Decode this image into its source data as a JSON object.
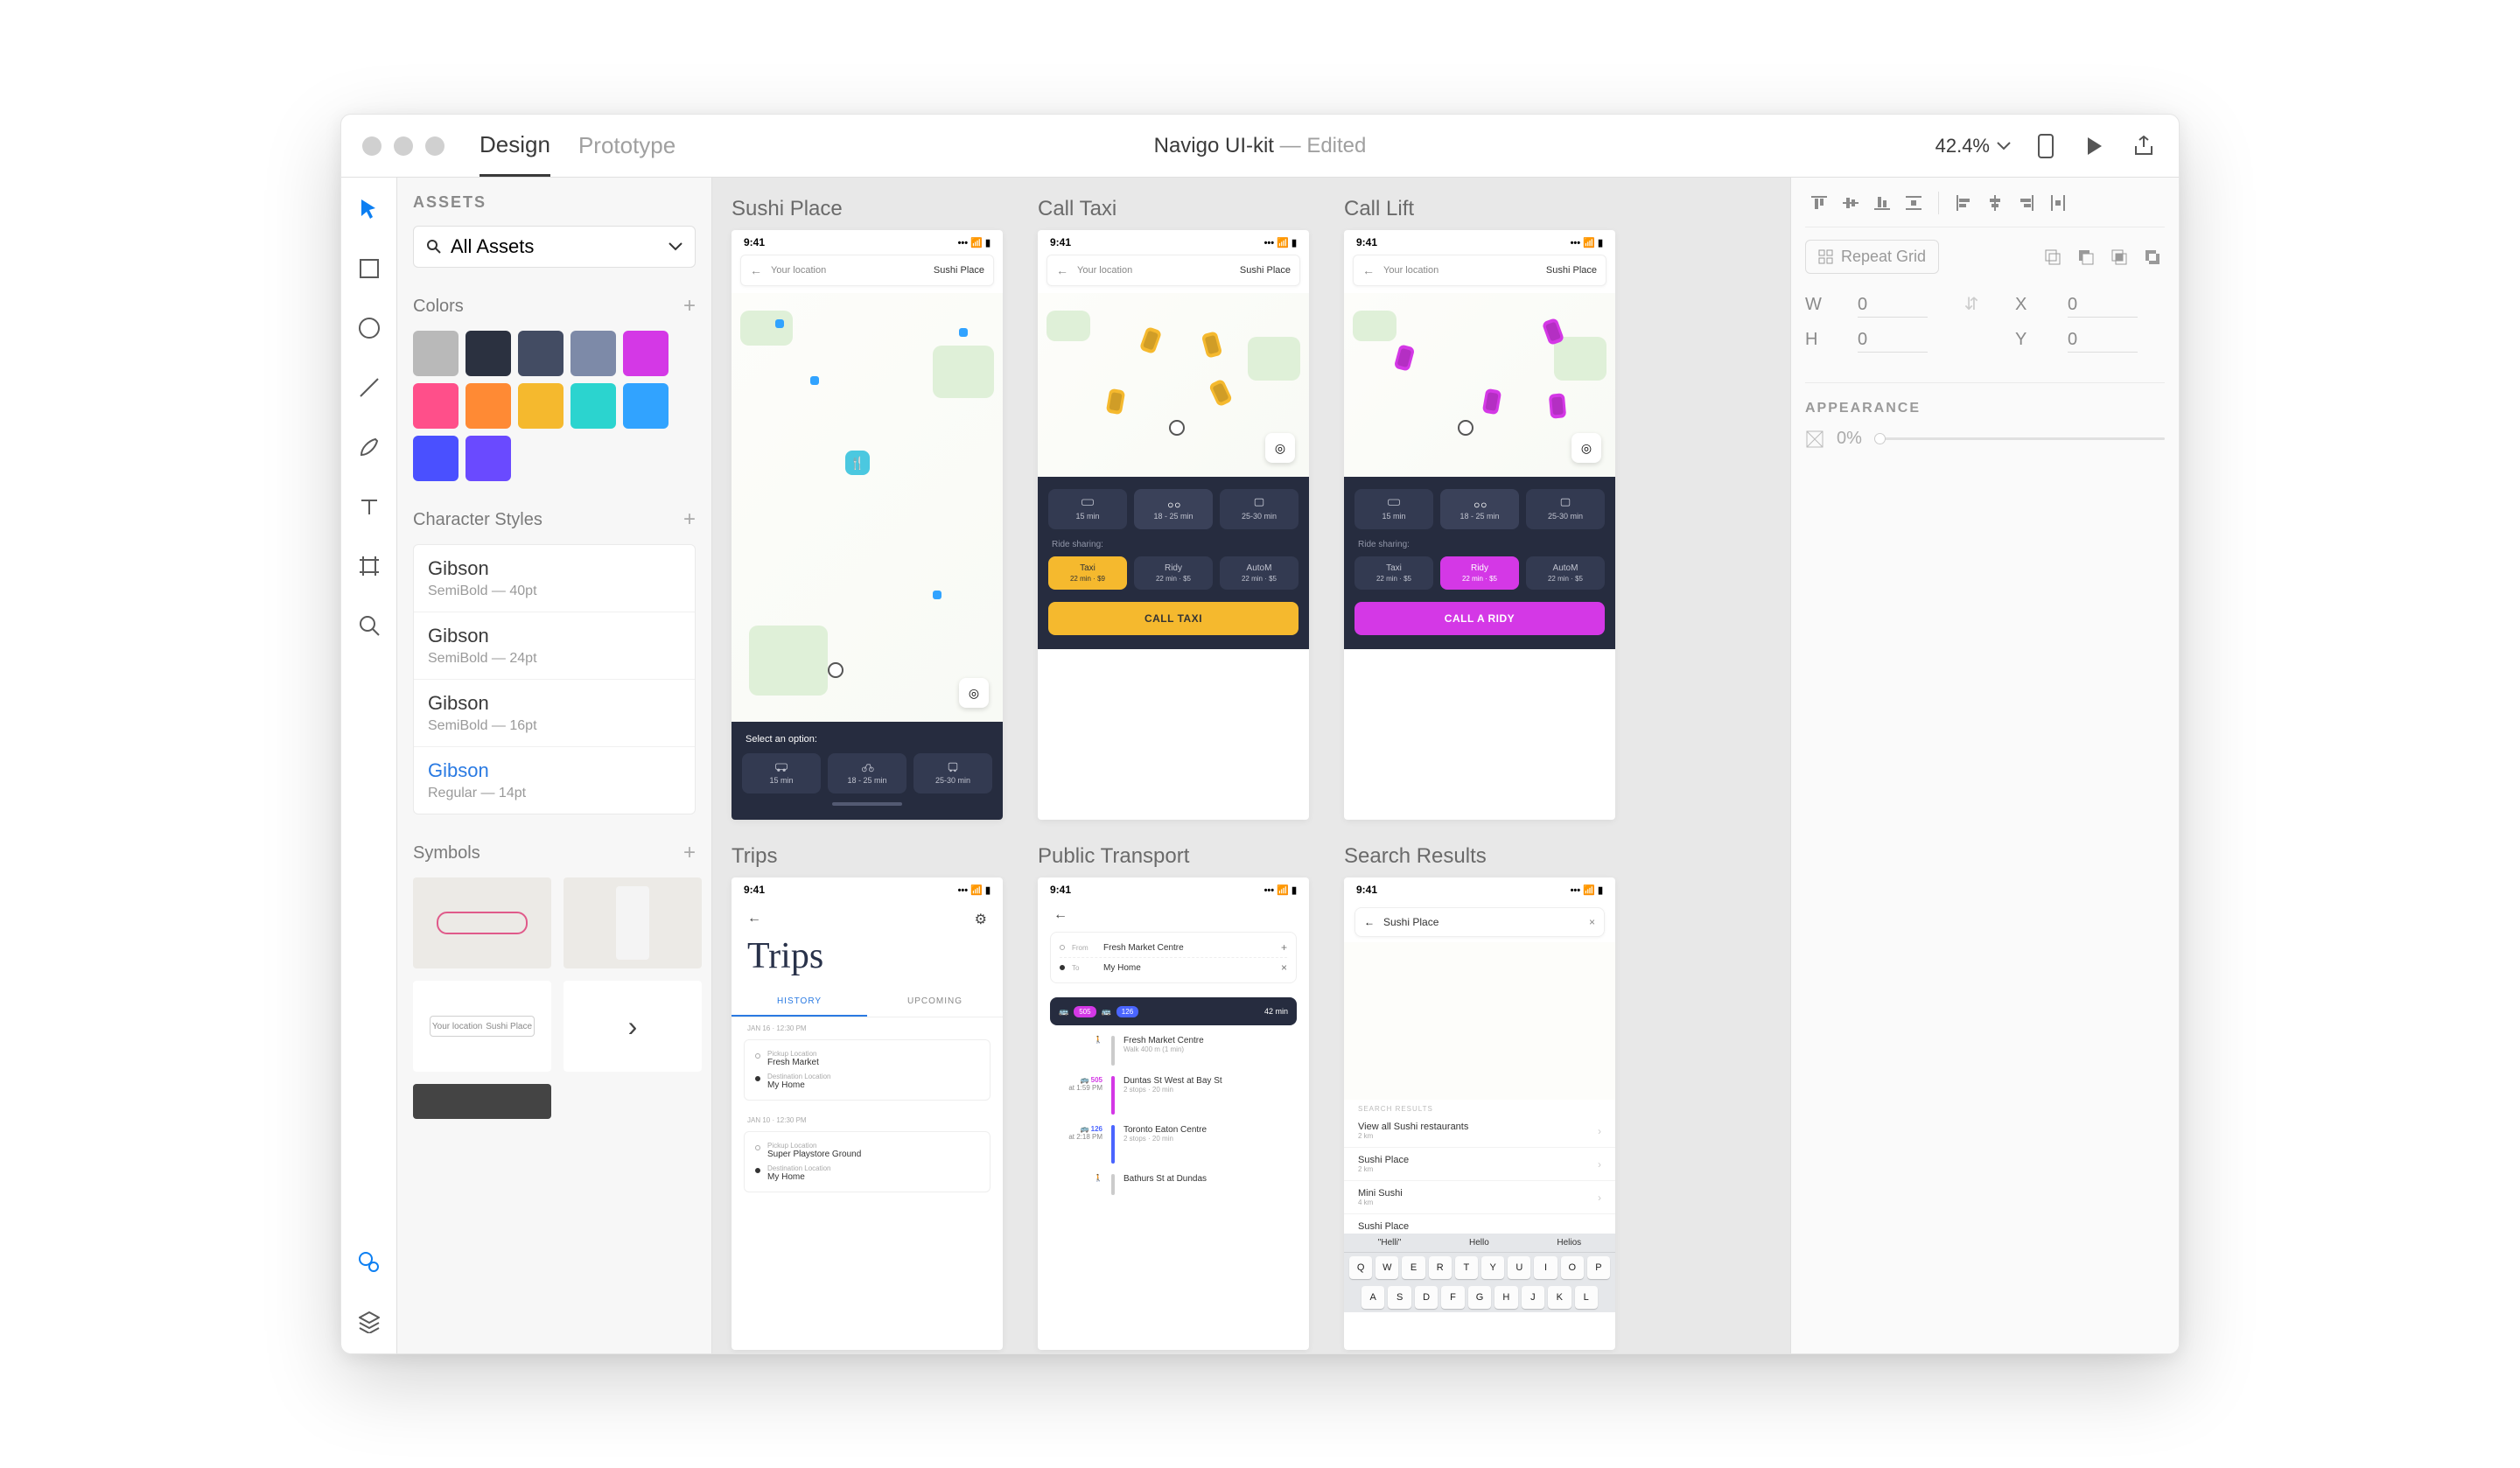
{
  "titlebar": {
    "tabs": {
      "design": "Design",
      "prototype": "Prototype"
    },
    "doc_title": "Navigo UI-kit",
    "separator": " — ",
    "edited": "Edited",
    "zoom": "42.4%"
  },
  "assets_panel": {
    "heading": "ASSETS",
    "dropdown": "All Assets",
    "colors": {
      "heading": "Colors",
      "swatches": [
        "#b9b9b9",
        "#2b3140",
        "#434c63",
        "#7d8aa8",
        "#d438e6",
        "#ff4f8a",
        "#ff8a34",
        "#f5b92e",
        "#2bd4cf",
        "#31a3ff",
        "#4a50ff",
        "#6a4aff"
      ]
    },
    "char_styles": {
      "heading": "Character Styles",
      "items": [
        {
          "name": "Gibson",
          "meta": "SemiBold — 40pt"
        },
        {
          "name": "Gibson",
          "meta": "SemiBold — 24pt"
        },
        {
          "name": "Gibson",
          "meta": "SemiBold — 16pt"
        },
        {
          "name": "Gibson",
          "meta": "Regular — 14pt"
        }
      ]
    },
    "symbols": {
      "heading": "Symbols",
      "searchbar_text_left": "Your location",
      "searchbar_text_right": "Sushi Place"
    }
  },
  "artboards": {
    "sushi": {
      "label": "Sushi Place",
      "time": "9:41",
      "loc_from": "Your location",
      "loc_to": "Sushi Place",
      "select_prompt": "Select an option:",
      "opts": [
        {
          "t": "15 min"
        },
        {
          "t": "18 - 25 min"
        },
        {
          "t": "25-30 min"
        }
      ]
    },
    "taxi": {
      "label": "Call Taxi",
      "time": "9:41",
      "loc_from": "Your location",
      "loc_to": "Sushi Place",
      "opts": [
        {
          "t": "15 min"
        },
        {
          "t": "18 - 25 min"
        },
        {
          "t": "25-30 min"
        }
      ],
      "share_label": "Ride sharing:",
      "shares": [
        {
          "name": "Taxi",
          "price": "22 min · $9"
        },
        {
          "name": "Ridy",
          "price": "22 min · $5"
        },
        {
          "name": "AutoM",
          "price": "22 min · $5"
        }
      ],
      "cta": "CALL TAXI"
    },
    "lift": {
      "label": "Call Lift",
      "time": "9:41",
      "loc_from": "Your location",
      "loc_to": "Sushi Place",
      "opts": [
        {
          "t": "15 min"
        },
        {
          "t": "18 - 25 min"
        },
        {
          "t": "25-30 min"
        }
      ],
      "share_label": "Ride sharing:",
      "shares": [
        {
          "name": "Taxi",
          "price": "22 min · $5"
        },
        {
          "name": "Ridy",
          "price": "22 min · $5"
        },
        {
          "name": "AutoM",
          "price": "22 min · $5"
        }
      ],
      "cta": "CALL A RIDY"
    },
    "trips": {
      "label": "Trips",
      "time": "9:41",
      "title": "Trips",
      "tab_history": "HISTORY",
      "tab_upcoming": "UPCOMING",
      "date1": "JAN 16 · 12:30 PM",
      "card1_pickup_label": "Pickup Location",
      "card1_pickup": "Fresh Market",
      "card1_dest_label": "Destination Location",
      "card1_dest": "My Home",
      "date2": "JAN 10 · 12:30 PM",
      "card2_pickup_label": "Pickup Location",
      "card2_pickup": "Super Playstore Ground",
      "card2_dest_label": "Destination Location",
      "card2_dest": "My Home"
    },
    "pt": {
      "label": "Public Transport",
      "time": "9:41",
      "from_label": "From",
      "from": "Fresh Market Centre",
      "to_label": "To",
      "to": "My Home",
      "route1": "505",
      "route2": "126",
      "duration": "42 min",
      "step1_title": "Fresh Market Centre",
      "step1_sub": "Walk 400 m (1 min)",
      "step2_left_line": "505",
      "step2_left_time": "at 1:59 PM",
      "step2_title": "Duntas St West at Bay St",
      "step2_sub": "2 stops · 20 min",
      "step3_left_line": "126",
      "step3_left_time": "at 2:18 PM",
      "step3_title": "Toronto Eaton Centre",
      "step3_sub": "2 stops · 20 min",
      "step4_title": "Bathurs St at Dundas"
    },
    "search": {
      "label": "Search Results",
      "time": "9:41",
      "query": "Sushi Place",
      "results_head": "SEARCH RESULTS",
      "r1_name": "View all Sushi restaurants",
      "r1_dist": "2 km",
      "r2_name": "Sushi Place",
      "r2_dist": "2 km",
      "r3_name": "Mini Sushi",
      "r3_dist": "4 km",
      "r4_name": "Sushi Place",
      "sug1": "\"Helli\"",
      "sug2": "Hello",
      "sug3": "Helios",
      "keys_r1": [
        "Q",
        "W",
        "E",
        "R",
        "T",
        "Y",
        "U",
        "I",
        "O",
        "P"
      ],
      "keys_r2": [
        "A",
        "S",
        "D",
        "F",
        "G",
        "H",
        "J",
        "K",
        "L"
      ]
    }
  },
  "inspector": {
    "repeat": "Repeat Grid",
    "W_label": "W",
    "W": "0",
    "X_label": "X",
    "X": "0",
    "H_label": "H",
    "H": "0",
    "Y_label": "Y",
    "Y": "0",
    "appearance": "APPEARANCE",
    "opacity": "0%"
  }
}
